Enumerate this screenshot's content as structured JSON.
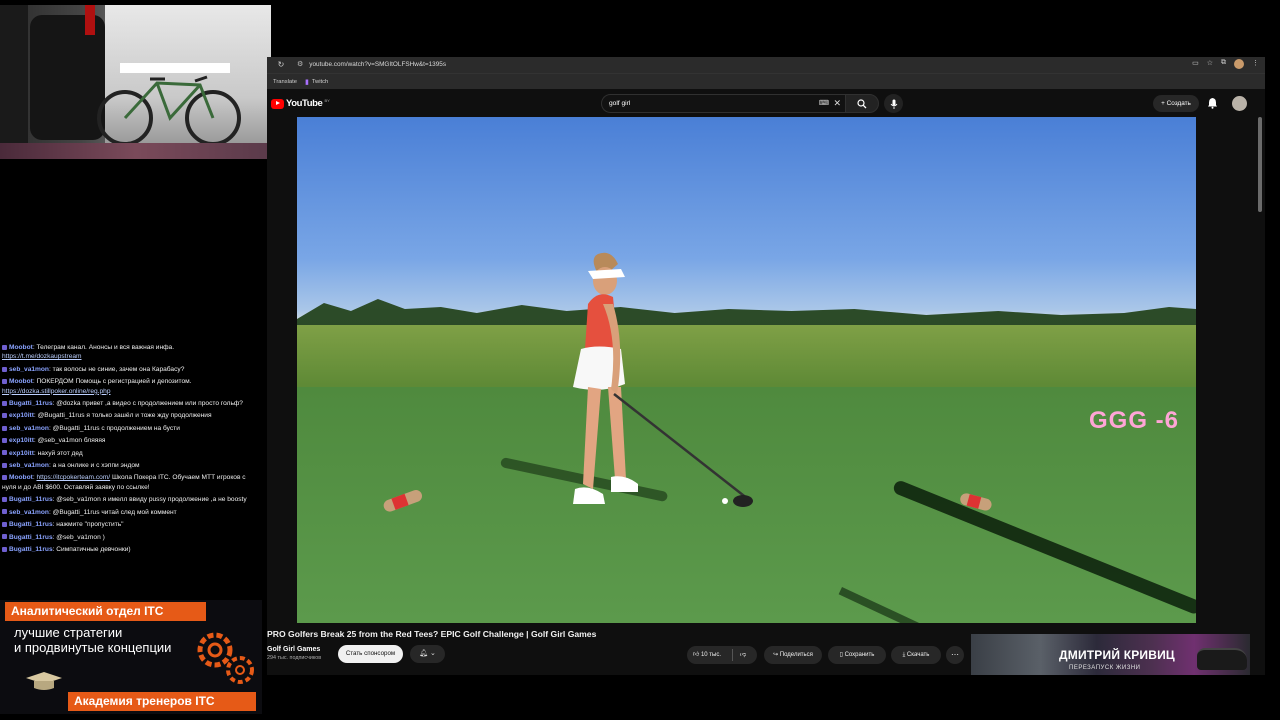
{
  "browser": {
    "url": "youtube.com/watch?v=SMGItOLFSHw&t=1395s",
    "bookmarks": [
      "Translate",
      "Twitch"
    ]
  },
  "youtube": {
    "logo_text": "YouTube",
    "logo_country": "BY",
    "search_value": "golf girl",
    "create_label": "+ Создать",
    "video_overlay_text": "GGG -6",
    "video_title": "PRO Golfers Break 25 from the Red Tees? EPIC Golf Challenge | Golf Girl Games",
    "channel_name": "Golf Girl Games",
    "subscribers": "294 тыс. подписчиков",
    "sponsor_label": "Стать спонсором",
    "likes": "10 тыс.",
    "share_label": "Поделиться",
    "save_label": "Сохранить",
    "download_label": "Скачать",
    "side_ad_title": "ДМИТРИЙ КРИВИЦ",
    "side_ad_subtitle": "ПЕРЕЗАПУСК ЖИЗНИ"
  },
  "chat": [
    {
      "user": "Moobot",
      "text": "Телеграм канал. Анонсы и вся важная инфа.",
      "link": "https://t.me/dozkaupstream"
    },
    {
      "user": "seb_va1mon",
      "text": "так волосы не синие, зачем она Карабасу?"
    },
    {
      "user": "Moobot",
      "text": "ПОКЕРДОМ Помощь с регистрацией и депозитом.",
      "link": "https://dozka.stillpoker.online/reg.php"
    },
    {
      "user": "Bugatti_11rus",
      "text": "@dozka привет ,а видео с продолжением или просто гольф?"
    },
    {
      "user": "exp10itt",
      "text": "@Bugatti_11rus я только зашёл и тоже жду продолжения"
    },
    {
      "user": "seb_va1mon",
      "text": "@Bugatti_11rus с продолжением на бусти"
    },
    {
      "user": "exp10itt",
      "text": "@seb_va1mon бляяяя"
    },
    {
      "user": "exp10itt",
      "text": "нахуй этот дед"
    },
    {
      "user": "seb_va1mon",
      "text": "а на онлике и с хэппи эндом"
    },
    {
      "user": "Moobot",
      "text_before": "",
      "link": "https://itcpokerteam.com/",
      "text": "Школа Покера ITC. Обучаем МТТ игроков с нуля и до ABI $600. Оставляй заявку по ссылке!"
    },
    {
      "user": "Bugatti_11rus",
      "text": "@seb_va1mon я имелл ввиду pussy продолжение ,а не boosty"
    },
    {
      "user": "seb_va1mon",
      "text": "@Bugatti_11rus читай след мой коммент"
    },
    {
      "user": "Bugatti_11rus",
      "text": "нажмите \"пропустить\""
    },
    {
      "user": "Bugatti_11rus",
      "text": "@seb_va1mon )"
    },
    {
      "user": "Bugatti_11rus",
      "text": "Симпатичные девчонки)"
    }
  ],
  "ad_banner": {
    "header": "Аналитический отдел ITC",
    "line1": "лучшие стратегии",
    "line2": "и продвинутые концепции",
    "footer": "Академия тренеров ITC"
  },
  "colors": {
    "accent_orange": "#e65a17",
    "yt_red": "#ff0000",
    "overlay_pink": "#ffa5d6"
  }
}
